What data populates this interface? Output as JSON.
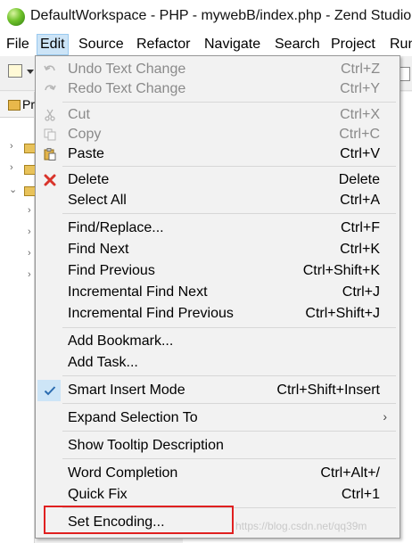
{
  "window": {
    "title": "DefaultWorkspace - PHP - mywebB/index.php - Zend Studio"
  },
  "menubar": {
    "items": [
      {
        "label": "File"
      },
      {
        "label": "Edit"
      },
      {
        "label": "Source"
      },
      {
        "label": "Refactor"
      },
      {
        "label": "Navigate"
      },
      {
        "label": "Search"
      },
      {
        "label": "Project"
      },
      {
        "label": "Run"
      }
    ],
    "active": "Edit"
  },
  "explorer": {
    "tab_label": "Pr"
  },
  "edit_menu": {
    "undo": {
      "label": "Undo Text Change",
      "accel": "Ctrl+Z",
      "enabled": false
    },
    "redo": {
      "label": "Redo Text Change",
      "accel": "Ctrl+Y",
      "enabled": false
    },
    "cut": {
      "label": "Cut",
      "accel": "Ctrl+X",
      "enabled": false
    },
    "copy": {
      "label": "Copy",
      "accel": "Ctrl+C",
      "enabled": false
    },
    "paste": {
      "label": "Paste",
      "accel": "Ctrl+V",
      "enabled": true
    },
    "delete": {
      "label": "Delete",
      "accel": "Delete",
      "enabled": true
    },
    "select_all": {
      "label": "Select All",
      "accel": "Ctrl+A",
      "enabled": true
    },
    "find_replace": {
      "label": "Find/Replace...",
      "accel": "Ctrl+F"
    },
    "find_next": {
      "label": "Find Next",
      "accel": "Ctrl+K"
    },
    "find_previous": {
      "label": "Find Previous",
      "accel": "Ctrl+Shift+K"
    },
    "incremental_find_next": {
      "label": "Incremental Find Next",
      "accel": "Ctrl+J"
    },
    "incremental_find_previous": {
      "label": "Incremental Find Previous",
      "accel": "Ctrl+Shift+J"
    },
    "add_bookmark": {
      "label": "Add Bookmark..."
    },
    "add_task": {
      "label": "Add Task..."
    },
    "smart_insert_mode": {
      "label": "Smart Insert Mode",
      "accel": "Ctrl+Shift+Insert",
      "checked": true
    },
    "expand_selection": {
      "label": "Expand Selection To",
      "submenu_icon": "chevron-right-icon"
    },
    "show_tooltip": {
      "label": "Show Tooltip Description"
    },
    "word_completion": {
      "label": "Word Completion",
      "accel": "Ctrl+Alt+/"
    },
    "quick_fix": {
      "label": "Quick Fix",
      "accel": "Ctrl+1"
    },
    "set_encoding": {
      "label": "Set Encoding..."
    }
  },
  "watermark": "https://blog.csdn.net/qq39m",
  "colors": {
    "menu_active_bg": "#cce4f7",
    "highlight_border": "#e02020",
    "delete_icon": "#d9342b",
    "check_icon": "#2b6cb0"
  }
}
